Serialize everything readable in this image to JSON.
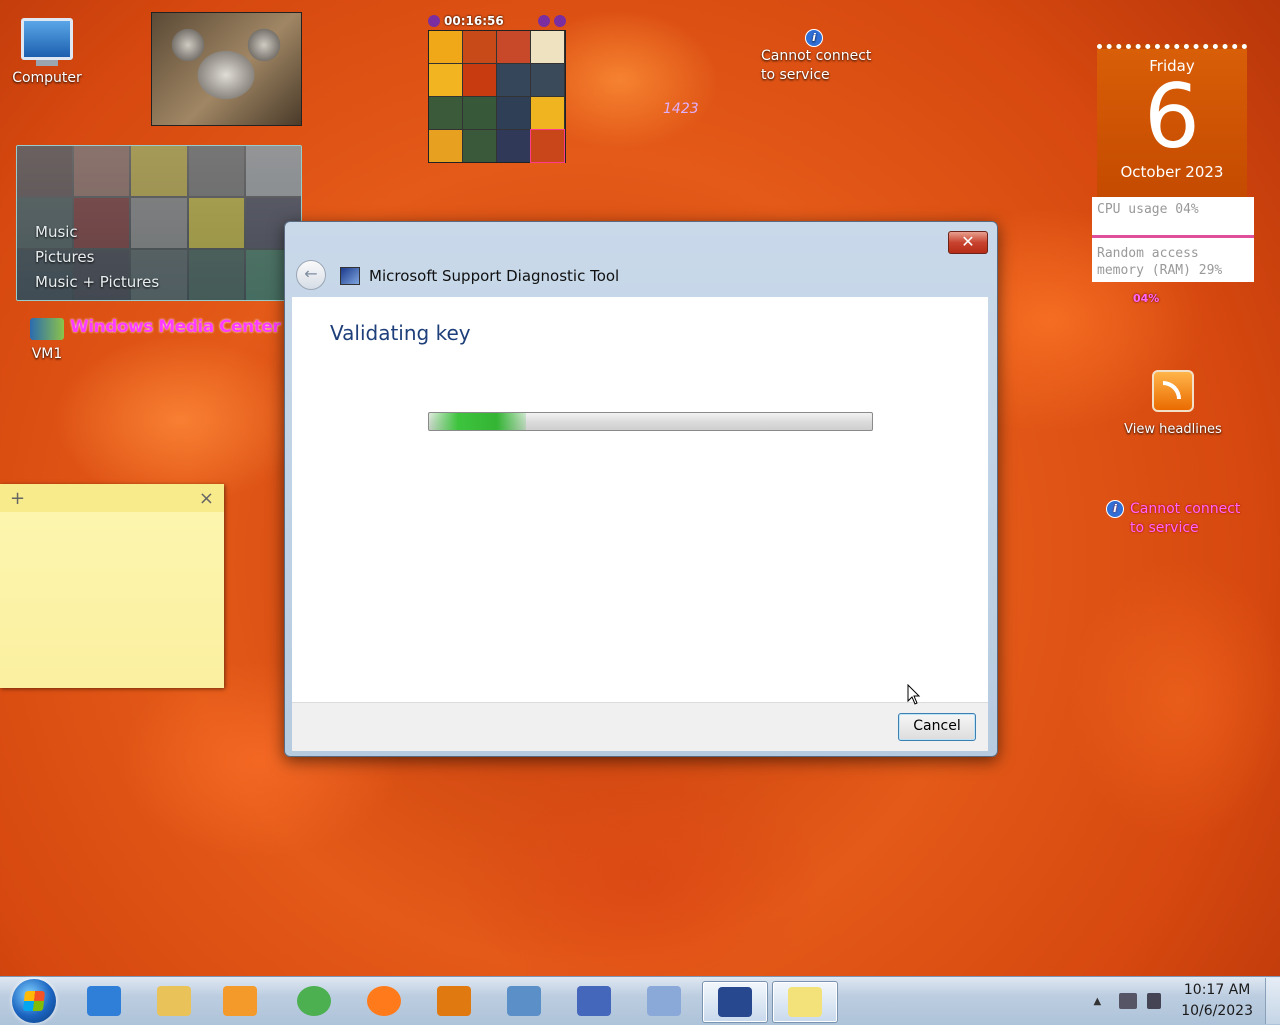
{
  "desktop": {
    "computer_label": "Computer",
    "vm1_label": "VM1",
    "media_center": {
      "menu": [
        "Music",
        "Pictures",
        "Music + Pictures"
      ],
      "app_label": "Windows Media Center"
    },
    "puzzle": {
      "timer": "00:16:56"
    },
    "stray_number": "1423",
    "info_top": {
      "line1": "Cannot connect",
      "line2": "to service"
    },
    "info_right": {
      "line1": "Cannot connect",
      "line2": "to service"
    },
    "calendar": {
      "weekday": "Friday",
      "day": "6",
      "month_year": "October 2023"
    },
    "meter": {
      "cpu": "CPU usage 04%",
      "ram_line1": "Random access",
      "ram_line2": "memory (RAM) 29%",
      "pct": "04%"
    },
    "feed": {
      "label": "View headlines"
    },
    "sticky": {
      "add": "+",
      "close": "×"
    }
  },
  "dialog": {
    "title": "Microsoft Support Diagnostic Tool",
    "close_glyph": "✕",
    "back_glyph": "←",
    "heading": "Validating key",
    "progress_fraction": 0.22,
    "cancel_label": "Cancel"
  },
  "taskbar": {
    "apps": [
      {
        "name": "internet-explorer",
        "color": "#2f7fd8"
      },
      {
        "name": "file-explorer",
        "color": "#e9c25a"
      },
      {
        "name": "media-player",
        "color": "#f39a2b"
      },
      {
        "name": "chrome",
        "color": "#4caf50"
      },
      {
        "name": "firefox",
        "color": "#ff7a1a"
      },
      {
        "name": "search-tool",
        "color": "#e07a10"
      },
      {
        "name": "control-panel",
        "color": "#5b8fc7"
      },
      {
        "name": "font-tool",
        "color": "#4466bb"
      },
      {
        "name": "paint",
        "color": "#8aa8d8"
      },
      {
        "name": "msdt",
        "color": "#27478f"
      },
      {
        "name": "sticky-notes",
        "color": "#f3e27a"
      }
    ],
    "time": "10:17 AM",
    "date": "10/6/2023"
  }
}
